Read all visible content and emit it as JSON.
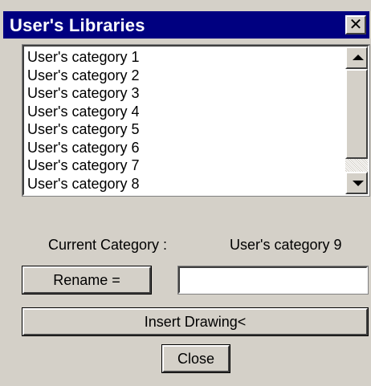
{
  "window": {
    "title": "User's Libraries",
    "close_glyph": "✕"
  },
  "category_list": {
    "items": [
      "User's category 1",
      "User's category 2",
      "User's category 3",
      "User's category 4",
      "User's category 5",
      "User's category 6",
      "User's category 7",
      "User's category 8"
    ]
  },
  "current": {
    "label": "Current Category :",
    "value": "User's category 9"
  },
  "rename": {
    "button_label": "Rename =",
    "field_value": ""
  },
  "insert": {
    "button_label": "Insert Drawing<"
  },
  "close": {
    "button_label": "Close"
  },
  "colors": {
    "titlebar": "#000080",
    "face": "#d4d0c8"
  },
  "icons": {
    "close": "close-icon",
    "scroll_up": "scroll-up-arrow-icon",
    "scroll_down": "scroll-down-arrow-icon"
  }
}
